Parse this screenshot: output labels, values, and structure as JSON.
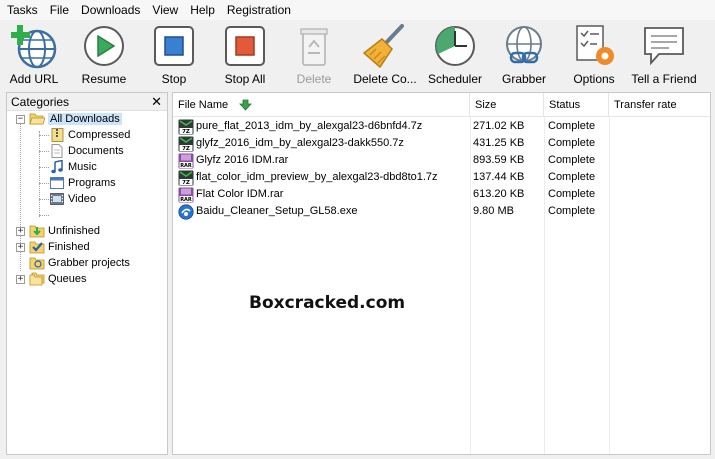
{
  "menu": [
    "Tasks",
    "File",
    "Downloads",
    "View",
    "Help",
    "Registration"
  ],
  "toolbar": {
    "add_url": "Add URL",
    "resume": "Resume",
    "stop": "Stop",
    "stop_all": "Stop All",
    "delete": "Delete",
    "delete_completed": "Delete Co...",
    "scheduler": "Scheduler",
    "grabber": "Grabber",
    "options": "Options",
    "tell_friend": "Tell a Friend"
  },
  "categories": {
    "title": "Categories",
    "close": "✕",
    "all_downloads": "All Downloads",
    "compressed": "Compressed",
    "documents": "Documents",
    "music": "Music",
    "programs": "Programs",
    "video": "Video",
    "unfinished": "Unfinished",
    "finished": "Finished",
    "grabber_projects": "Grabber projects",
    "queues": "Queues"
  },
  "columns": {
    "file_name": "File Name",
    "size": "Size",
    "status": "Status",
    "transfer_rate": "Transfer rate"
  },
  "files": [
    {
      "name": "pure_flat_2013_idm_by_alexgal23-d6bnfd4.7z",
      "size": "271.02  KB",
      "status": "Complete",
      "type": "7z"
    },
    {
      "name": "glyfz_2016_idm_by_alexgal23-dakk550.7z",
      "size": "431.25  KB",
      "status": "Complete",
      "type": "7z"
    },
    {
      "name": "Glyfz 2016 IDM.rar",
      "size": "893.59  KB",
      "status": "Complete",
      "type": "rar"
    },
    {
      "name": "flat_color_idm_preview_by_alexgal23-dbd8to1.7z",
      "size": "137.44  KB",
      "status": "Complete",
      "type": "7z"
    },
    {
      "name": "Flat Color IDM.rar",
      "size": "613.20  KB",
      "status": "Complete",
      "type": "rar"
    },
    {
      "name": "Baidu_Cleaner_Setup_GL58.exe",
      "size": "9.80  MB",
      "status": "Complete",
      "type": "exe"
    }
  ],
  "watermark": "Boxcracked.com"
}
